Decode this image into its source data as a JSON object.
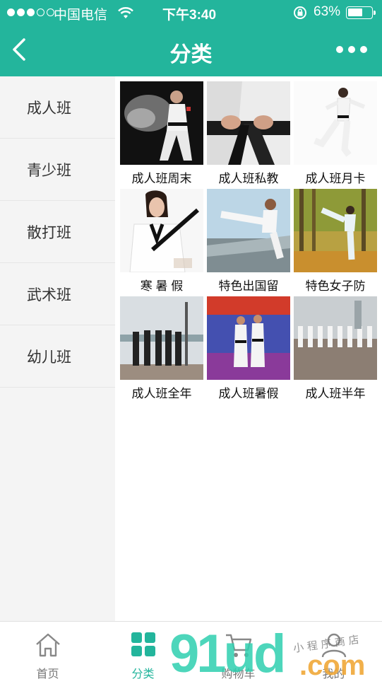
{
  "status_bar": {
    "carrier": "中国电信",
    "time": "下午3:40",
    "battery": "63%",
    "battery_level": 0.63
  },
  "header": {
    "title": "分类",
    "back_icon": "chevron-left-icon",
    "more_icon": "more-dots-icon"
  },
  "sidebar": {
    "items": [
      {
        "label": "成人班"
      },
      {
        "label": "青少班"
      },
      {
        "label": "散打班"
      },
      {
        "label": "武术班"
      },
      {
        "label": "幼儿班"
      }
    ]
  },
  "grid": {
    "items": [
      {
        "label": "成人班周末",
        "image": "woman-kick-powder-photo"
      },
      {
        "label": "成人班私教",
        "image": "black-belt-closeup-photo"
      },
      {
        "label": "成人班月卡",
        "image": "girl-jump-kick-photo"
      },
      {
        "label": "寒 暑 假",
        "image": "woman-nunchaku-photo"
      },
      {
        "label": "特色出国留",
        "image": "man-flying-kick-photo"
      },
      {
        "label": "特色女子防",
        "image": "woman-forest-kick-photo"
      },
      {
        "label": "成人班全年",
        "image": "group-lakeside-photo"
      },
      {
        "label": "成人班暑假",
        "image": "two-athletes-stage-photo"
      },
      {
        "label": "成人班半年",
        "image": "team-line-kick-photo"
      }
    ]
  },
  "tabbar": {
    "tabs": [
      {
        "label": "首页",
        "icon": "home-icon"
      },
      {
        "label": "分类",
        "icon": "category-grid-icon"
      },
      {
        "label": "购物车",
        "icon": "cart-icon"
      },
      {
        "label": "我的",
        "icon": "user-icon"
      }
    ],
    "active_color": "#23b59c"
  },
  "watermark": {
    "text": "91ud.com",
    "subtext": "小 程 序 商 店"
  },
  "colors": {
    "brand": "#23b59c",
    "sidebar_bg": "#f4f4f4"
  }
}
